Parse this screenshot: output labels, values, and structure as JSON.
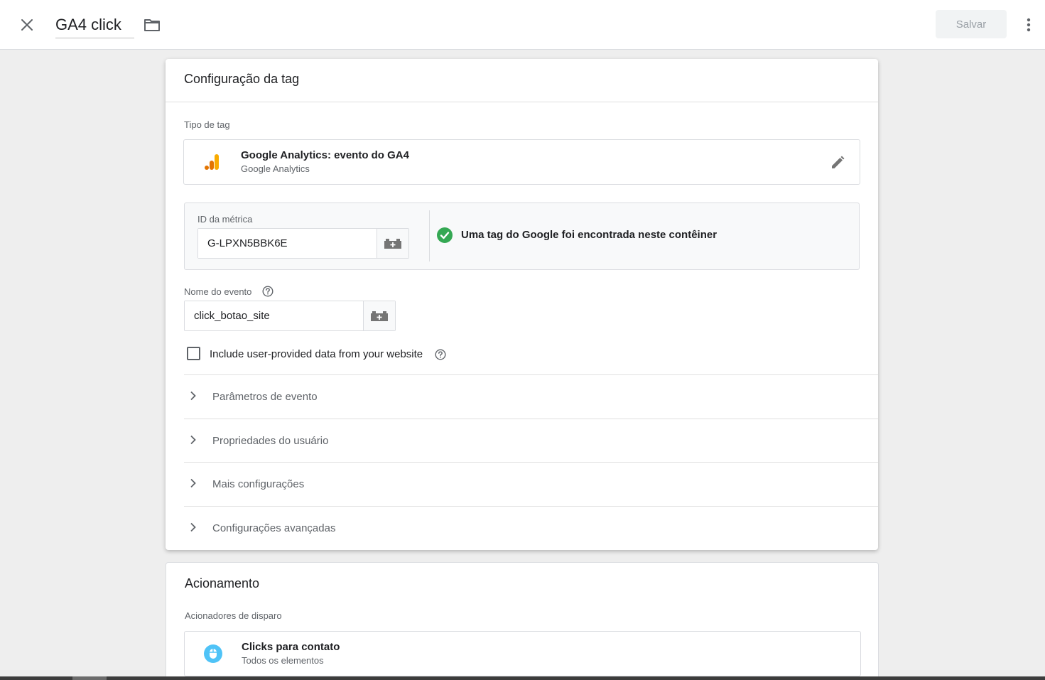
{
  "header": {
    "tag_title": "GA4 click",
    "save_label": "Salvar"
  },
  "config": {
    "card_title": "Configuração da tag",
    "tag_type_label": "Tipo de tag",
    "tag_type": {
      "name": "Google Analytics: evento do GA4",
      "provider": "Google Analytics"
    },
    "measurement": {
      "label": "ID da métrica",
      "value": "G-LPXN5BBK6E",
      "found_message": "Uma tag do Google foi encontrada neste contêiner"
    },
    "event_name": {
      "label": "Nome do evento",
      "value": "click_botao_site"
    },
    "user_data_checkbox": {
      "label": "Include user-provided data from your website",
      "checked": false
    },
    "sections": [
      {
        "label": "Parâmetros de evento"
      },
      {
        "label": "Propriedades do usuário"
      },
      {
        "label": "Mais configurações"
      },
      {
        "label": "Configurações avançadas"
      }
    ]
  },
  "triggering": {
    "card_title": "Acionamento",
    "triggers_label": "Acionadores de disparo",
    "triggers": [
      {
        "name": "Clicks para contato",
        "type": "Todos os elementos"
      }
    ]
  },
  "colors": {
    "ga_orange": "#f9ab00",
    "ga_dark_orange": "#e37400",
    "check_green": "#34a853",
    "trigger_blue": "#4fc3f7"
  }
}
